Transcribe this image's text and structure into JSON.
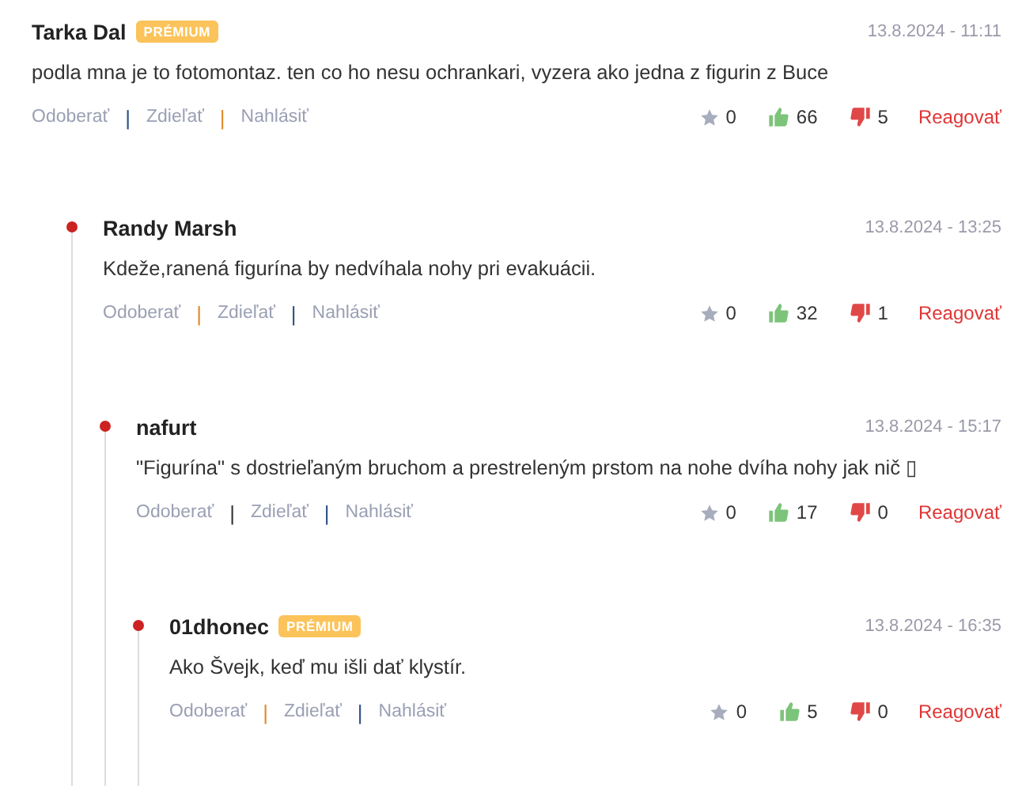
{
  "comments": [
    {
      "author": "Tarka Dal",
      "badge": "PRÉMIUM",
      "date": "13.8.2024 - 11:11",
      "text": "podla mna je to fotomontaz. ten co ho nesu ochrankari, vyzera ako jedna z figurin z Buce",
      "actions": [
        {
          "label": "Odoberať"
        },
        {
          "label": "Zdieľať",
          "separator": {
            "text": "|",
            "color": "#2e4f86"
          }
        },
        {
          "label": "Nahlásiť",
          "separator": {
            "text": "|",
            "color": "#e08a2a"
          }
        }
      ],
      "stars": "0",
      "likes": "66",
      "dislikes": "5",
      "reply": "Reagovať",
      "children": [
        {
          "author": "Randy Marsh",
          "date": "13.8.2024 - 13:25",
          "text": "Kdeže,ranená figurína by nedvíhala nohy pri evakuácii.",
          "actions": [
            {
              "label": "Odoberať"
            },
            {
              "label": "Zdieľať",
              "separator": {
                "text": "|",
                "color": "#e08a2a"
              }
            },
            {
              "label": "Nahlásiť",
              "separator": {
                "text": "|",
                "color": "#2e4f86"
              }
            }
          ],
          "stars": "0",
          "likes": "32",
          "dislikes": "1",
          "reply": "Reagovať",
          "children": [
            {
              "author": "nafurt",
              "date": "13.8.2024 - 15:17",
              "text": "\"Figurína\" s dostrieľaným bruchom a prestreleným prstom na nohe dvíha nohy jak nič ▯",
              "actions": [
                {
                  "label": "Odoberať"
                },
                {
                  "label": "Zdieľať",
                  "separator": {
                    "text": "|",
                    "color": "#333333"
                  }
                },
                {
                  "label": "Nahlásiť",
                  "separator": {
                    "text": "|",
                    "color": "#2e4f86"
                  }
                }
              ],
              "stars": "0",
              "likes": "17",
              "dislikes": "0",
              "reply": "Reagovať",
              "children": [
                {
                  "author": "01dhonec",
                  "badge": "PRÉMIUM",
                  "date": "13.8.2024 - 16:35",
                  "text": "Ako Švejk, keď mu išli dať klystír.",
                  "actions": [
                    {
                      "label": "Odoberať"
                    },
                    {
                      "label": "Zdieľať",
                      "separator": {
                        "text": "|",
                        "color": "#e08a2a"
                      }
                    },
                    {
                      "label": "Nahlásiť",
                      "separator": {
                        "text": "|",
                        "color": "#2e4f86"
                      }
                    }
                  ],
                  "stars": "0",
                  "likes": "5",
                  "dislikes": "0",
                  "reply": "Reagovať"
                }
              ]
            }
          ]
        }
      ]
    }
  ]
}
